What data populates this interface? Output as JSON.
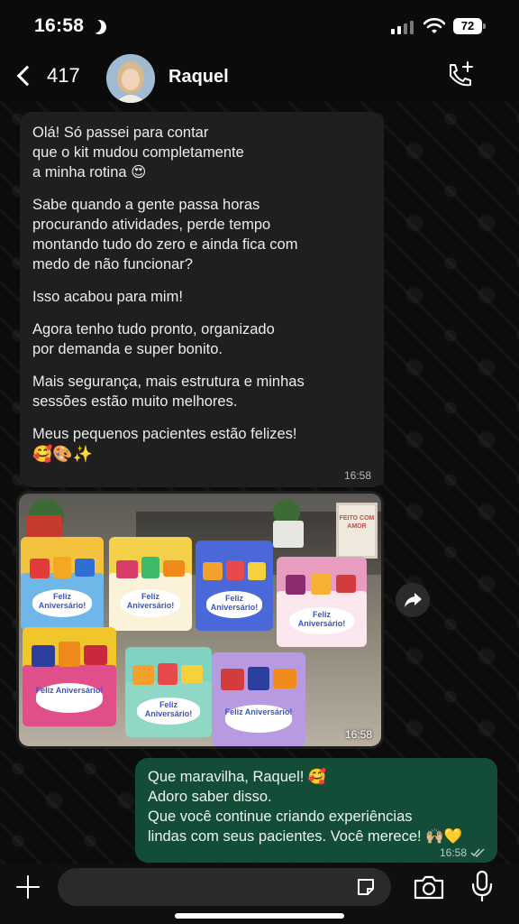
{
  "status_bar": {
    "time": "16:58",
    "battery": "72"
  },
  "header": {
    "back_count": "417",
    "contact_name": "Raquel"
  },
  "incoming_message": {
    "paragraphs": [
      "Olá! Só passei para contar\nque o kit mudou completamente\na minha rotina 😍",
      "Sabe quando a gente passa horas\nprocurando atividades, perde tempo\nmontando tudo do zero e ainda fica com\nmedo de não funcionar?",
      "Isso acabou para mim!",
      "Agora tenho tudo pronto, organizado\npor demanda e super bonito.",
      "Mais segurança, mais estrutura e minhas\nsessões estão muito melhores.",
      "Meus pequenos pacientes estão felizes!"
    ],
    "emoji_line": "🥰🎨✨",
    "time": "16:58"
  },
  "image_message": {
    "time": "16:58",
    "sign_text": "FEITO COM AMOR",
    "box_label": "Feliz Aniversário!"
  },
  "outgoing_message": {
    "text": "Que maravilha, Raquel! 🥰\nAdoro saber disso.\nQue você continue criando experiências\nlindas com seus pacientes. Você merece! 🙌🏼💛",
    "time": "16:58"
  },
  "composer": {
    "placeholder": ""
  },
  "colors": {
    "incoming_bubble": "#1f1f1f",
    "outgoing_bubble": "#144d37",
    "background": "#0b0b0b"
  }
}
